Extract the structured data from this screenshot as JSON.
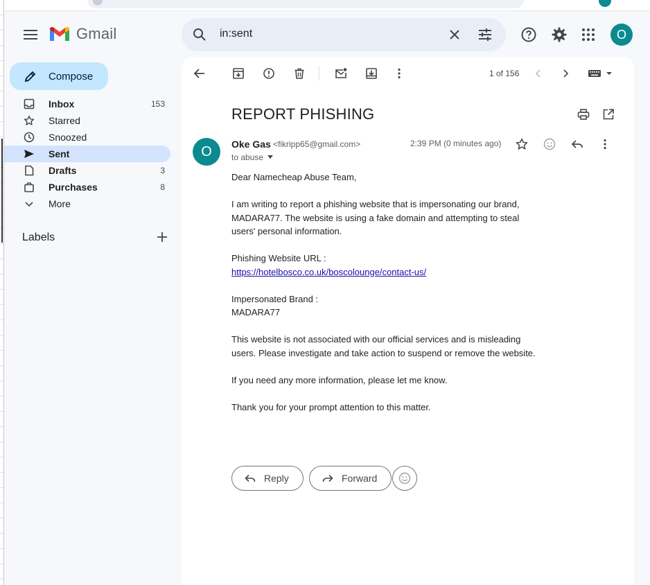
{
  "app": {
    "logo_text": "Gmail"
  },
  "search": {
    "query": "in:sent"
  },
  "header": {
    "avatar_letter": "O"
  },
  "compose": {
    "label": "Compose"
  },
  "nav": [
    {
      "name": "inbox",
      "label": "Inbox",
      "count": "153",
      "bold": true,
      "active": false
    },
    {
      "name": "starred",
      "label": "Starred",
      "count": "",
      "bold": false,
      "active": false
    },
    {
      "name": "snoozed",
      "label": "Snoozed",
      "count": "",
      "bold": false,
      "active": false
    },
    {
      "name": "sent",
      "label": "Sent",
      "count": "",
      "bold": true,
      "active": true
    },
    {
      "name": "drafts",
      "label": "Drafts",
      "count": "3",
      "bold": true,
      "active": false
    },
    {
      "name": "purchases",
      "label": "Purchases",
      "count": "8",
      "bold": true,
      "active": false
    },
    {
      "name": "more",
      "label": "More",
      "count": "",
      "bold": false,
      "active": false
    }
  ],
  "labels": {
    "title": "Labels"
  },
  "toolbar": {
    "pager": "1 of 156"
  },
  "message": {
    "subject": "REPORT PHISHING",
    "sender_name": "Oke Gas",
    "sender_email": "<fikripp65@gmail.com>",
    "sender_initial": "O",
    "to": "to abuse",
    "time": "2:39 PM (0 minutes ago)",
    "greeting": "Dear Namecheap Abuse Team,",
    "para1": "I am writing to report a phishing website that is impersonating our brand, MADARA77. The website is using a fake domain and attempting to steal users' personal information.",
    "url_label": "Phishing Website URL :",
    "url": "https://hotelbosco.co.uk/boscolounge/contact-us/",
    "brand_label": "Impersonated Brand :",
    "brand": "MADARA77",
    "para2": "This website is not associated with our official services and is misleading users. Please investigate and take action to suspend or remove the website.",
    "para3": "If you need any more information, please let me know.",
    "para4": "Thank you for your prompt attention to this matter."
  },
  "actions": {
    "reply": "Reply",
    "forward": "Forward"
  }
}
